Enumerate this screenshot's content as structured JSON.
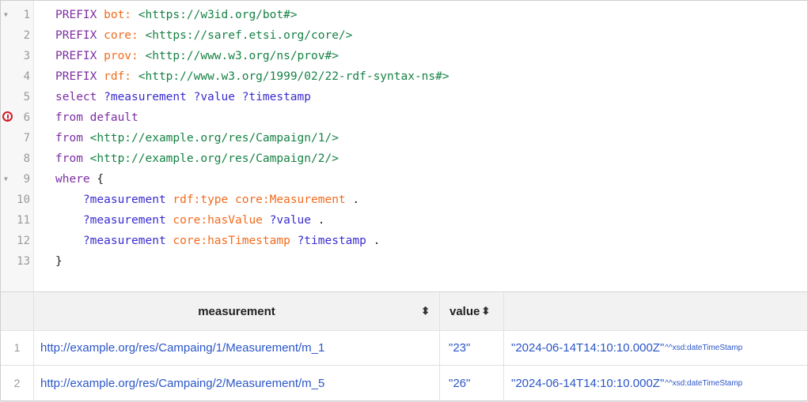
{
  "editor": {
    "lines": [
      {
        "n": "1",
        "tokens": [
          [
            "kw",
            "PREFIX "
          ],
          [
            "pfx",
            "bot:"
          ],
          [
            "pn",
            " "
          ],
          [
            "iri",
            "<https://w3id.org/bot#>"
          ]
        ]
      },
      {
        "n": "2",
        "tokens": [
          [
            "kw",
            "PREFIX "
          ],
          [
            "pfx",
            "core:"
          ],
          [
            "pn",
            " "
          ],
          [
            "iri",
            "<https://saref.etsi.org/core/>"
          ]
        ]
      },
      {
        "n": "3",
        "tokens": [
          [
            "kw",
            "PREFIX "
          ],
          [
            "pfx",
            "prov:"
          ],
          [
            "pn",
            " "
          ],
          [
            "iri",
            "<http://www.w3.org/ns/prov#>"
          ]
        ]
      },
      {
        "n": "4",
        "tokens": [
          [
            "kw",
            "PREFIX "
          ],
          [
            "pfx",
            "rdf:"
          ],
          [
            "pn",
            " "
          ],
          [
            "iri",
            "<http://www.w3.org/1999/02/22-rdf-syntax-ns#>"
          ]
        ]
      },
      {
        "n": "5",
        "tokens": [
          [
            "kw",
            "select "
          ],
          [
            "var",
            "?measurement ?value ?timestamp"
          ]
        ]
      },
      {
        "n": "6",
        "tokens": [
          [
            "kw",
            "from default"
          ]
        ]
      },
      {
        "n": "7",
        "tokens": [
          [
            "kw",
            "from "
          ],
          [
            "iri",
            "<http://example.org/res/Campaign/1/>"
          ]
        ]
      },
      {
        "n": "8",
        "tokens": [
          [
            "kw",
            "from "
          ],
          [
            "iri",
            "<http://example.org/res/Campaign/2/>"
          ]
        ]
      },
      {
        "n": "9",
        "tokens": [
          [
            "kw",
            "where "
          ],
          [
            "pn",
            "{"
          ]
        ]
      },
      {
        "n": "10",
        "tokens": [
          [
            "pn",
            "    "
          ],
          [
            "var",
            "?measurement "
          ],
          [
            "pfx",
            "rdf:type core:Measurement"
          ],
          [
            "pn",
            " ."
          ]
        ]
      },
      {
        "n": "11",
        "tokens": [
          [
            "pn",
            "    "
          ],
          [
            "var",
            "?measurement "
          ],
          [
            "pfx",
            "core:hasValue "
          ],
          [
            "var",
            "?value"
          ],
          [
            "pn",
            " ."
          ]
        ]
      },
      {
        "n": "12",
        "tokens": [
          [
            "pn",
            "    "
          ],
          [
            "var",
            "?measurement "
          ],
          [
            "pfx",
            "core:hasTimestamp "
          ],
          [
            "var",
            "?timestamp"
          ],
          [
            "pn",
            " ."
          ]
        ]
      },
      {
        "n": "13",
        "tokens": [
          [
            "pn",
            "}"
          ]
        ]
      }
    ]
  },
  "results": {
    "columns": [
      "measurement",
      "value",
      ""
    ],
    "sort_icon": "⬍",
    "rows": [
      {
        "index": "1",
        "measurement": "http://example.org/res/Campaing/1/Measurement/m_1",
        "value": "\"23\"",
        "timestamp": "\"2024-06-14T14:10:10.000Z\"",
        "datatype": "^^xsd:dateTimeStamp"
      },
      {
        "index": "2",
        "measurement": "http://example.org/res/Campaing/2/Measurement/m_5",
        "value": "\"26\"",
        "timestamp": "\"2024-06-14T14:10:10.000Z\"",
        "datatype": "^^xsd:dateTimeStamp"
      }
    ]
  }
}
